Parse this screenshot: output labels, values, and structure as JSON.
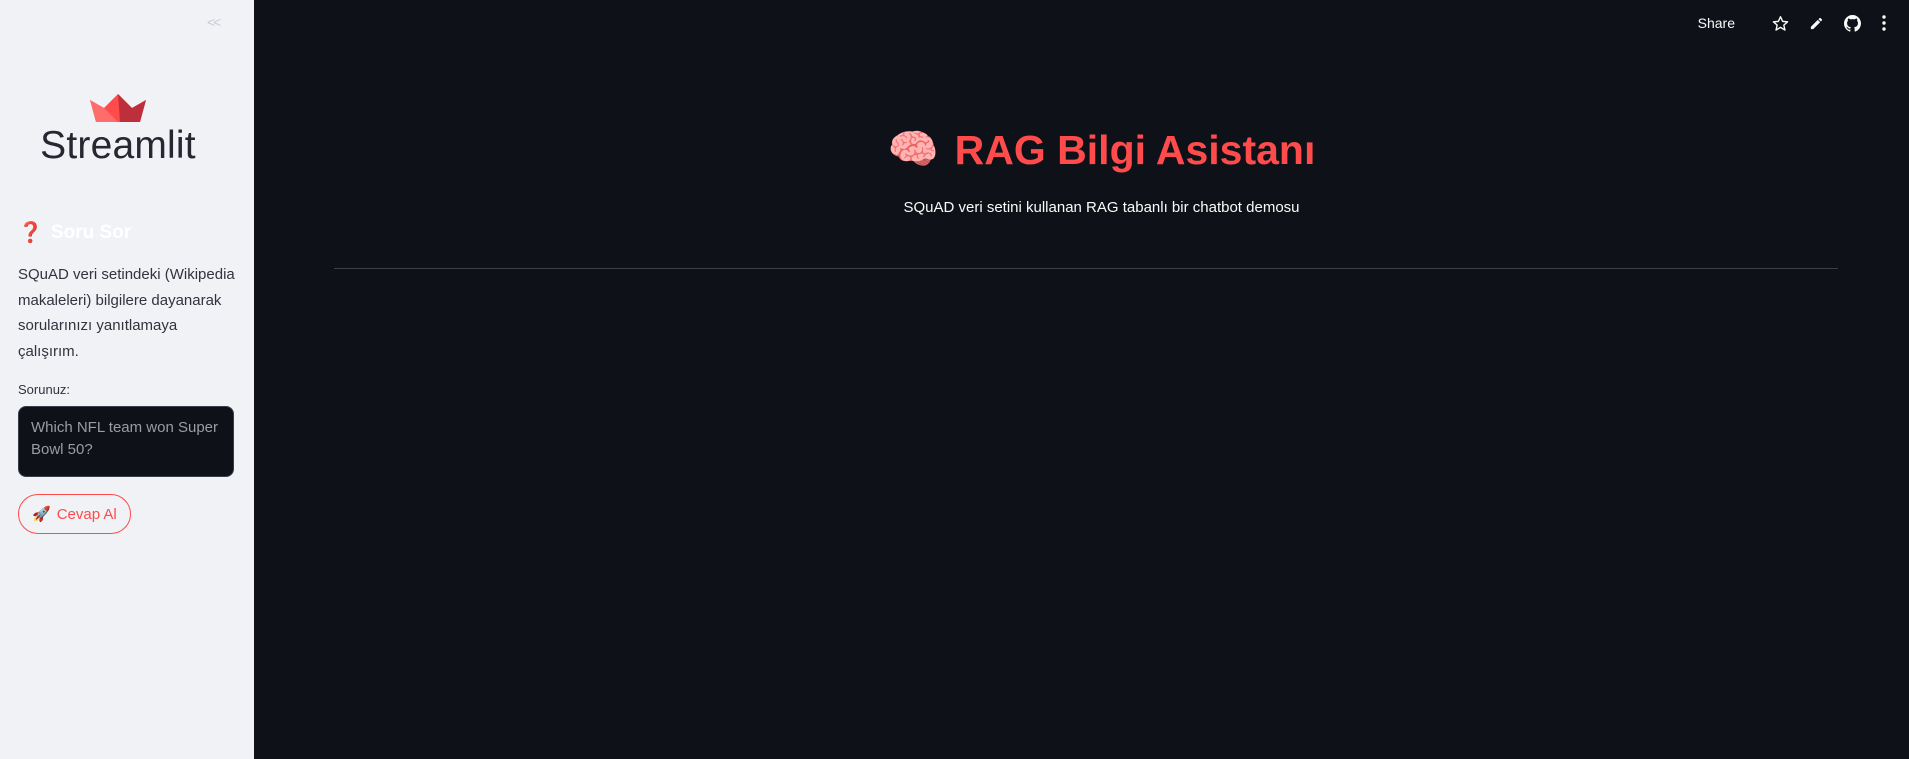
{
  "sidebar": {
    "collapse_icon": "double-chevron-left",
    "logo_text": "Streamlit",
    "heading": "Soru Sor",
    "heading_icon": "question-mark-icon",
    "description": "SQuAD veri setindeki (Wikipedia makaleleri) bilgilere dayanarak sorularınızı yanıtlamaya çalışırım.",
    "input_label": "Sorunuz:",
    "input_placeholder": "Which NFL team won Super Bowl 50?",
    "input_value": "",
    "button_label": "Cevap Al",
    "button_icon": "rocket-icon"
  },
  "toolbar": {
    "share_label": "Share",
    "icons": [
      "star-icon",
      "pencil-icon",
      "github-icon",
      "kebab-menu-icon"
    ]
  },
  "main": {
    "title": "RAG Bilgi Asistanı",
    "title_icon": "brain-icon",
    "subtitle": "SQuAD veri setini kullanan RAG tabanlı bir chatbot demosu"
  },
  "colors": {
    "accent": "#ff4b4b",
    "sidebar_bg": "#f0f2f6",
    "main_bg": "#0e1117",
    "text_light": "#fafafa",
    "text_dark": "#31333f"
  }
}
